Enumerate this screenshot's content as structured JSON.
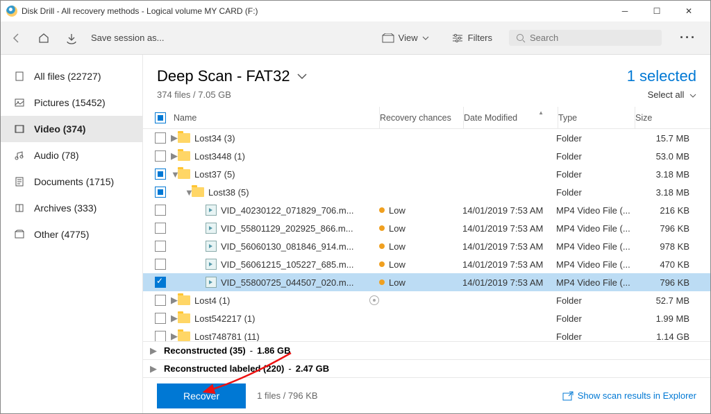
{
  "window": {
    "title": "Disk Drill - All recovery methods - Logical volume MY CARD (F:)"
  },
  "toolbar": {
    "save_session": "Save session as...",
    "view": "View",
    "filters": "Filters",
    "search_placeholder": "Search"
  },
  "sidebar": {
    "items": [
      {
        "label": "All files (22727)",
        "icon": "files"
      },
      {
        "label": "Pictures (15452)",
        "icon": "pictures"
      },
      {
        "label": "Video (374)",
        "icon": "video"
      },
      {
        "label": "Audio (78)",
        "icon": "audio"
      },
      {
        "label": "Documents (1715)",
        "icon": "documents"
      },
      {
        "label": "Archives (333)",
        "icon": "archives"
      },
      {
        "label": "Other (4775)",
        "icon": "other"
      }
    ]
  },
  "header": {
    "title": "Deep Scan - FAT32",
    "subtitle": "374 files / 7.05 GB",
    "selected": "1 selected",
    "select_all": "Select all"
  },
  "columns": {
    "name": "Name",
    "recovery": "Recovery chances",
    "date": "Date Modified",
    "type": "Type",
    "size": "Size"
  },
  "rows": [
    {
      "chk": "empty",
      "indent": 0,
      "tog": "▶",
      "icon": "folder",
      "name": "Lost34 (3)",
      "rec": "",
      "date": "",
      "type": "Folder",
      "size": "15.7 MB"
    },
    {
      "chk": "empty",
      "indent": 0,
      "tog": "▶",
      "icon": "folder",
      "name": "Lost3448 (1)",
      "rec": "",
      "date": "",
      "type": "Folder",
      "size": "53.0 MB"
    },
    {
      "chk": "mixed",
      "indent": 0,
      "tog": "▼",
      "icon": "folder",
      "name": "Lost37 (5)",
      "rec": "",
      "date": "",
      "type": "Folder",
      "size": "3.18 MB"
    },
    {
      "chk": "mixed",
      "indent": 1,
      "tog": "▼",
      "icon": "folder",
      "name": "Lost38 (5)",
      "rec": "",
      "date": "",
      "type": "Folder",
      "size": "3.18 MB"
    },
    {
      "chk": "empty",
      "indent": 2,
      "tog": "",
      "icon": "video",
      "name": "VID_40230122_071829_706.m...",
      "rec": "Low",
      "date": "14/01/2019 7:53 AM",
      "type": "MP4 Video File (...",
      "size": "216 KB"
    },
    {
      "chk": "empty",
      "indent": 2,
      "tog": "",
      "icon": "video",
      "name": "VID_55801129_202925_866.m...",
      "rec": "Low",
      "date": "14/01/2019 7:53 AM",
      "type": "MP4 Video File (...",
      "size": "796 KB"
    },
    {
      "chk": "empty",
      "indent": 2,
      "tog": "",
      "icon": "video",
      "name": "VID_56060130_081846_914.m...",
      "rec": "Low",
      "date": "14/01/2019 7:53 AM",
      "type": "MP4 Video File (...",
      "size": "978 KB"
    },
    {
      "chk": "empty",
      "indent": 2,
      "tog": "",
      "icon": "video",
      "name": "VID_56061215_105227_685.m...",
      "rec": "Low",
      "date": "14/01/2019 7:53 AM",
      "type": "MP4 Video File (...",
      "size": "470 KB"
    },
    {
      "chk": "checked",
      "indent": 2,
      "tog": "",
      "icon": "video",
      "name": "VID_55800725_044507_020.m...",
      "rec": "Low",
      "date": "14/01/2019 7:53 AM",
      "type": "MP4 Video File (...",
      "size": "796 KB",
      "selected": true
    },
    {
      "chk": "empty",
      "indent": 0,
      "tog": "▶",
      "icon": "folder",
      "name": "Lost4 (1)",
      "rec": "",
      "date": "",
      "type": "Folder",
      "size": "52.7 MB",
      "eye": true
    },
    {
      "chk": "empty",
      "indent": 0,
      "tog": "▶",
      "icon": "folder",
      "name": "Lost542217 (1)",
      "rec": "",
      "date": "",
      "type": "Folder",
      "size": "1.99 MB"
    },
    {
      "chk": "empty",
      "indent": 0,
      "tog": "▶",
      "icon": "folder",
      "name": "Lost748781 (11)",
      "rec": "",
      "date": "",
      "type": "Folder",
      "size": "1.14 GB"
    }
  ],
  "summaries": [
    {
      "label": "Reconstructed (35)",
      "size": "1.86 GB"
    },
    {
      "label": "Reconstructed labeled (220)",
      "size": "2.47 GB"
    }
  ],
  "footer": {
    "recover": "Recover",
    "stat": "1 files / 796 KB",
    "explorer": "Show scan results in Explorer"
  }
}
